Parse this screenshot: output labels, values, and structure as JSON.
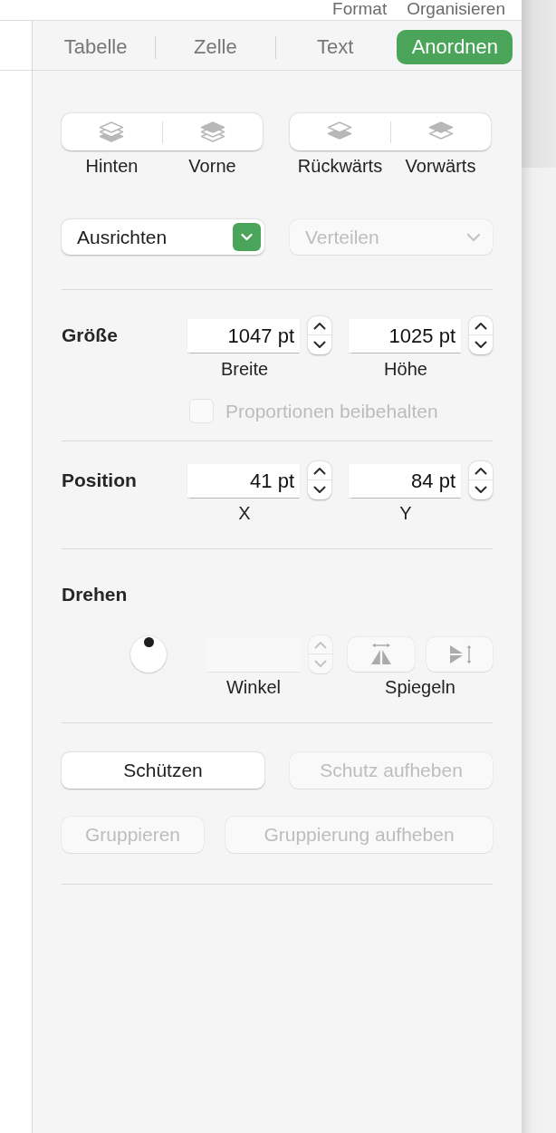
{
  "toolbar": {
    "items": [
      {
        "label": "Format"
      },
      {
        "label": "Organisieren"
      }
    ]
  },
  "tabs": [
    {
      "label": "Tabelle",
      "selected": false
    },
    {
      "label": "Zelle",
      "selected": false
    },
    {
      "label": "Text",
      "selected": false
    },
    {
      "label": "Anordnen",
      "selected": true
    }
  ],
  "layer_groups": [
    {
      "buttons": [
        {
          "label": "Hinten",
          "kind": "to_back"
        },
        {
          "label": "Vorne",
          "kind": "to_front"
        }
      ]
    },
    {
      "buttons": [
        {
          "label": "Rückwärts",
          "kind": "backward"
        },
        {
          "label": "Vorwärts",
          "kind": "forward"
        }
      ]
    }
  ],
  "align_menus": [
    {
      "label": "Ausrichten",
      "disabled": false
    },
    {
      "label": "Verteilen",
      "disabled": true
    }
  ],
  "size": {
    "label": "Größe",
    "fields": [
      {
        "value": "1047 pt",
        "caption": "Breite"
      },
      {
        "value": "1025 pt",
        "caption": "Höhe"
      }
    ],
    "constrain": {
      "label": "Proportionen beibehalten",
      "checked": false,
      "disabled": true
    }
  },
  "position": {
    "label": "Position",
    "fields": [
      {
        "value": "41 pt",
        "caption": "X"
      },
      {
        "value": "84 pt",
        "caption": "Y"
      }
    ]
  },
  "rotate": {
    "label": "Drehen",
    "angle": {
      "caption": "Winkel",
      "disabled": true
    },
    "flip": {
      "caption": "Spiegeln",
      "buttons": [
        {
          "kind": "horizontal",
          "disabled": true
        },
        {
          "kind": "vertical",
          "disabled": true
        }
      ]
    }
  },
  "lock_buttons": [
    {
      "label": "Schützen",
      "disabled": false
    },
    {
      "label": "Schutz aufheben",
      "disabled": true
    }
  ],
  "group_buttons": [
    {
      "label": "Gruppieren",
      "disabled": true
    },
    {
      "label": "Gruppierung aufheben",
      "disabled": true
    }
  ]
}
